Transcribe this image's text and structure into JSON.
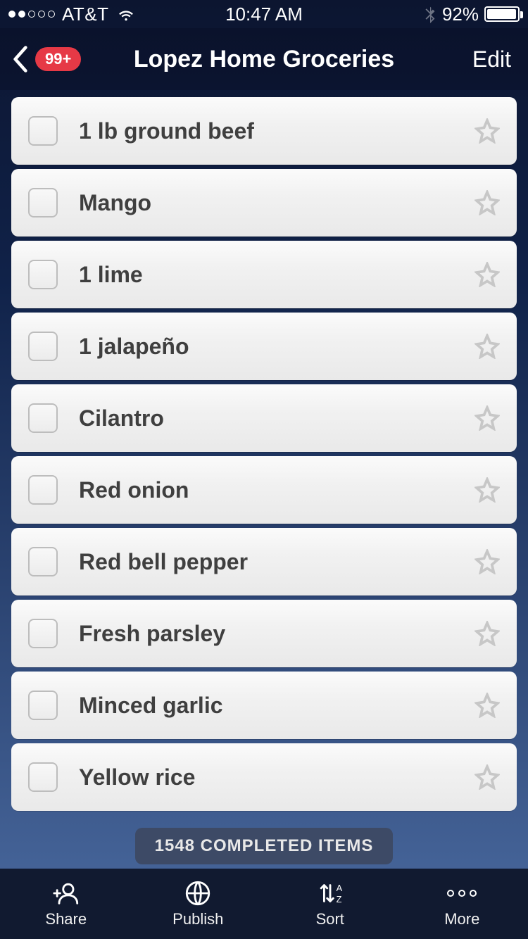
{
  "statusbar": {
    "carrier": "AT&T",
    "time": "10:47 AM",
    "battery_pct": "92%"
  },
  "nav": {
    "badge": "99+",
    "title": "Lopez Home Groceries",
    "edit": "Edit"
  },
  "items": [
    {
      "label": "1 lb ground beef"
    },
    {
      "label": "Mango"
    },
    {
      "label": "1 lime"
    },
    {
      "label": "1 jalapeño"
    },
    {
      "label": "Cilantro"
    },
    {
      "label": "Red onion"
    },
    {
      "label": "Red bell pepper"
    },
    {
      "label": "Fresh parsley"
    },
    {
      "label": "Minced garlic"
    },
    {
      "label": "Yellow rice"
    }
  ],
  "completed": "1548 COMPLETED ITEMS",
  "tabs": {
    "share": "Share",
    "publish": "Publish",
    "sort": "Sort",
    "more": "More"
  }
}
